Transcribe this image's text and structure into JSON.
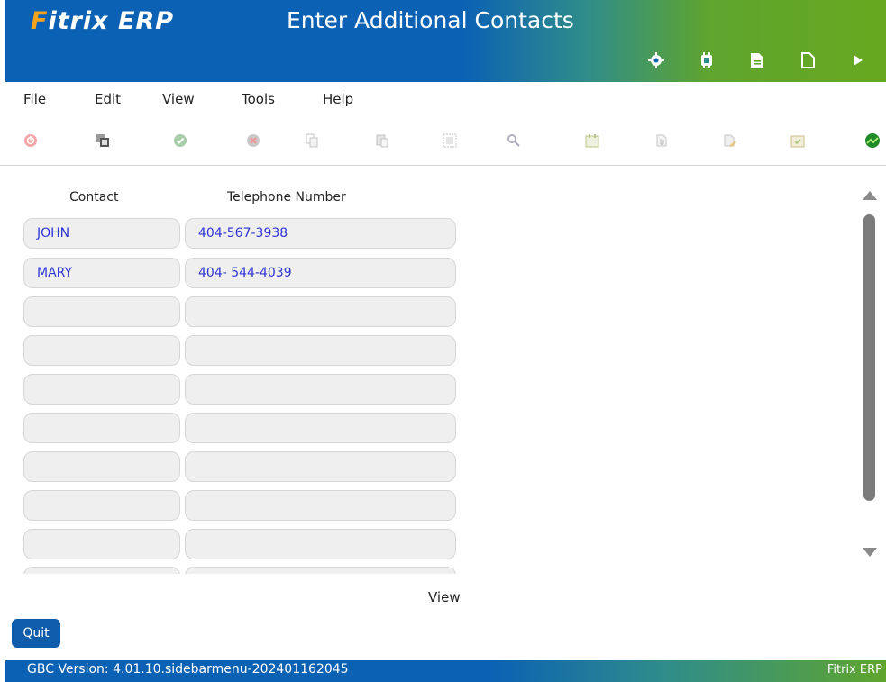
{
  "header": {
    "logo_main": "Fitrix",
    "logo_suffix": "ERP",
    "title": "Enter Additional Contacts",
    "icons": [
      "settings-icon",
      "chip-icon",
      "document-filled-icon",
      "document-outline-icon",
      "play-icon"
    ]
  },
  "menu": {
    "items": [
      "File",
      "Edit",
      "View",
      "Tools",
      "Help"
    ]
  },
  "toolbar": {
    "icons": [
      "power-icon",
      "copy-window-icon",
      "accept-icon",
      "cancel-icon",
      "copy-icon",
      "paste-icon",
      "select-icon",
      "find-icon",
      "calendar-icon",
      "attach-icon",
      "edit-document-icon",
      "checklist-icon",
      "graph-icon"
    ]
  },
  "table": {
    "headers": {
      "contact": "Contact",
      "telephone": "Telephone Number"
    },
    "rows": [
      {
        "contact": "JOHN",
        "telephone": "404-567-3938"
      },
      {
        "contact": "MARY",
        "telephone": "404- 544-4039"
      },
      {
        "contact": "",
        "telephone": ""
      },
      {
        "contact": "",
        "telephone": ""
      },
      {
        "contact": "",
        "telephone": ""
      },
      {
        "contact": "",
        "telephone": ""
      },
      {
        "contact": "",
        "telephone": ""
      },
      {
        "contact": "",
        "telephone": ""
      },
      {
        "contact": "",
        "telephone": ""
      },
      {
        "contact": "",
        "telephone": ""
      }
    ]
  },
  "mode_label": "View",
  "quit_label": "Quit",
  "footer": {
    "version": "GBC Version: 4.01.10.sidebarmenu-202401162045",
    "brand": "Fitrix ERP"
  },
  "colors": {
    "brand_blue": "#0b61b4",
    "brand_green": "#67a81f",
    "field_text": "#2f35d6"
  }
}
